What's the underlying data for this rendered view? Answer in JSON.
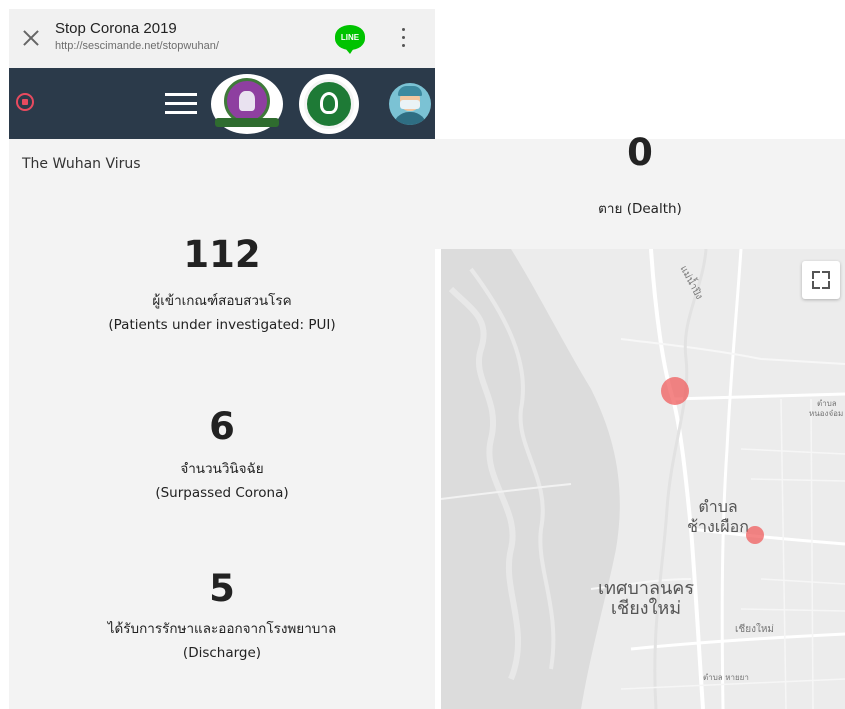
{
  "browser": {
    "title": "Stop Corona 2019",
    "url": "http://sescimande.net/stopwuhan/",
    "line_label": "LINE",
    "icons": [
      "close-icon",
      "line-app-icon",
      "more-vertical-icon"
    ]
  },
  "nav": {
    "icons": [
      "record-icon",
      "hamburger-menu-icon",
      "provincial-seal-logo",
      "ministry-of-public-health-logo",
      "doctor-avatar"
    ],
    "colors": {
      "background": "#2b3a4a",
      "record": "#e84a5f"
    }
  },
  "page": {
    "title": "The Wuhan Virus"
  },
  "stats": {
    "pui": {
      "value": "112",
      "label_th": "ผู้เข้าเกณฑ์สอบสวนโรค",
      "label_en": "(Patients under investigated: PUI)"
    },
    "surpassed": {
      "value": "6",
      "label_th": "จำนวนวินิจฉัย",
      "label_en": "(Surpassed Corona)"
    },
    "discharge": {
      "value": "5",
      "label_th": "ได้รับการรักษาและออกจากโรงพยาบาล",
      "label_en": "(Discharge)"
    },
    "death": {
      "value": "0",
      "label": "ตาย (Dealth)"
    }
  },
  "map": {
    "labels": {
      "river": "แม่น้ำปิง",
      "tambon_top": "ตำบล",
      "tambon_top_2": "หนองจ๋อม",
      "tambon_chang_1": "ตำบล",
      "tambon_chang_2": "ช้างเผือก",
      "city_1": "เทศบาลนคร",
      "city_2": "เชียงใหม่",
      "chiangmai": "เชียงใหม่",
      "hai_ya": "ตำบล หายยา"
    },
    "markers": 2,
    "marker_color": "#f05858",
    "icons": [
      "fullscreen-icon"
    ]
  }
}
